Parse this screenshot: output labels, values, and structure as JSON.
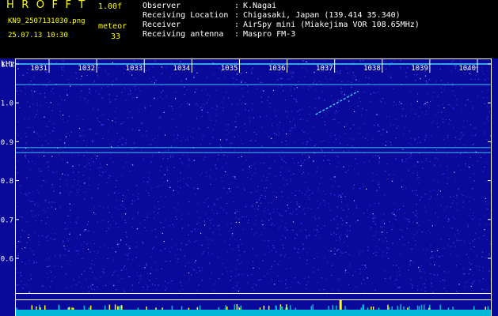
{
  "header": {
    "app_title": "HROFFT",
    "version": "1.00f",
    "filename": "KN9_2507131030.png",
    "mode": "meteor",
    "timestamp": "25.07.13 10:30",
    "count": "33"
  },
  "metadata": [
    {
      "label": "Observer",
      "value": "K.Nagai"
    },
    {
      "label": "Receiving Location",
      "value": "Chigasaki, Japan (139.414 35.340)"
    },
    {
      "label": "Receiver",
      "value": "AirSpy mini (Miakejima VOR 108.65MHz)"
    },
    {
      "label": "Receiving antenna",
      "value": "Maspro FM-3"
    }
  ],
  "separator": ":",
  "axes": {
    "y_unit": "kHz",
    "x_ticks": [
      "1031",
      "1032",
      "1033",
      "1034",
      "1035",
      "1036",
      "1037",
      "1038",
      "1039",
      "1040"
    ],
    "y_ticks": [
      "1.1",
      "1.0",
      "0.9",
      "0.8",
      "0.7",
      "0.6"
    ],
    "y_range": [
      0.58,
      1.16
    ]
  },
  "signals": {
    "carrier_freqs_khz": [
      1.1,
      1.047,
      0.885,
      0.872
    ],
    "meteor_trace": {
      "start_x": 1036.6,
      "end_x": 1037.5,
      "start_y": 0.97,
      "end_y": 1.03
    }
  },
  "colors": {
    "background": "#0a0a9a",
    "noise_light": "#3a52ff",
    "signal": "#40d8ff",
    "accent": "#ffff00",
    "baseline": "#00b8d8"
  }
}
